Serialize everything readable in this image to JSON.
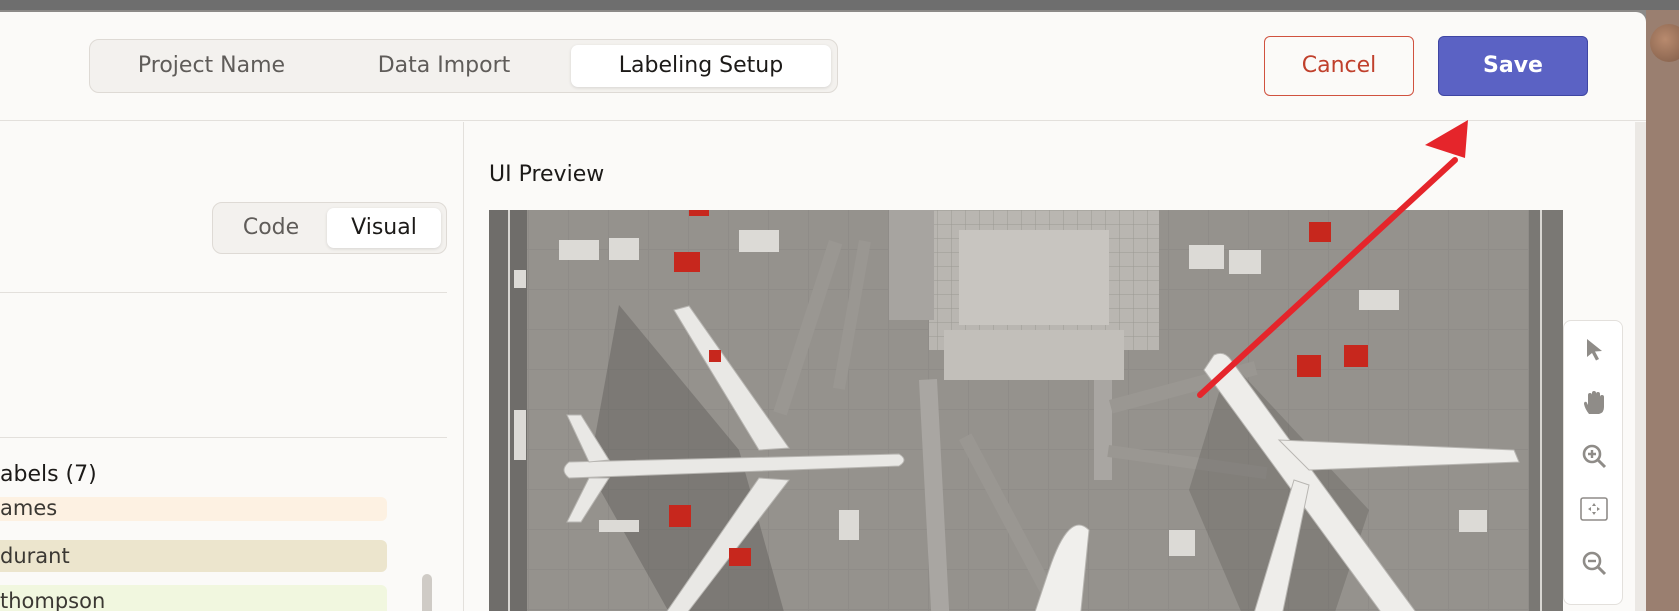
{
  "wizard": {
    "tabs": [
      {
        "label": "Project Name"
      },
      {
        "label": "Data Import"
      },
      {
        "label": "Labeling Setup"
      }
    ],
    "active_tab": "Labeling Setup",
    "cancel_label": "Cancel",
    "save_label": "Save"
  },
  "config": {
    "mode_tabs": [
      {
        "label": "Code"
      },
      {
        "label": "Visual"
      }
    ],
    "active_mode": "Visual",
    "labels_title": "abels (7)",
    "labels": [
      {
        "label": "ames",
        "color": "#fdf1e2"
      },
      {
        "label": "durant",
        "color": "#ece5cd"
      },
      {
        "label": "thompson",
        "color": "#f1f7df"
      }
    ]
  },
  "preview": {
    "title": "UI Preview"
  },
  "tools": [
    {
      "icon": "pointer-icon"
    },
    {
      "icon": "hand-pan-icon"
    },
    {
      "icon": "zoom-in-icon"
    },
    {
      "icon": "fit-to-screen-icon"
    },
    {
      "icon": "zoom-out-icon"
    }
  ],
  "colors": {
    "accent": "#5b62c4",
    "cancel": "#c0402c",
    "annotation": "#e5252b"
  }
}
